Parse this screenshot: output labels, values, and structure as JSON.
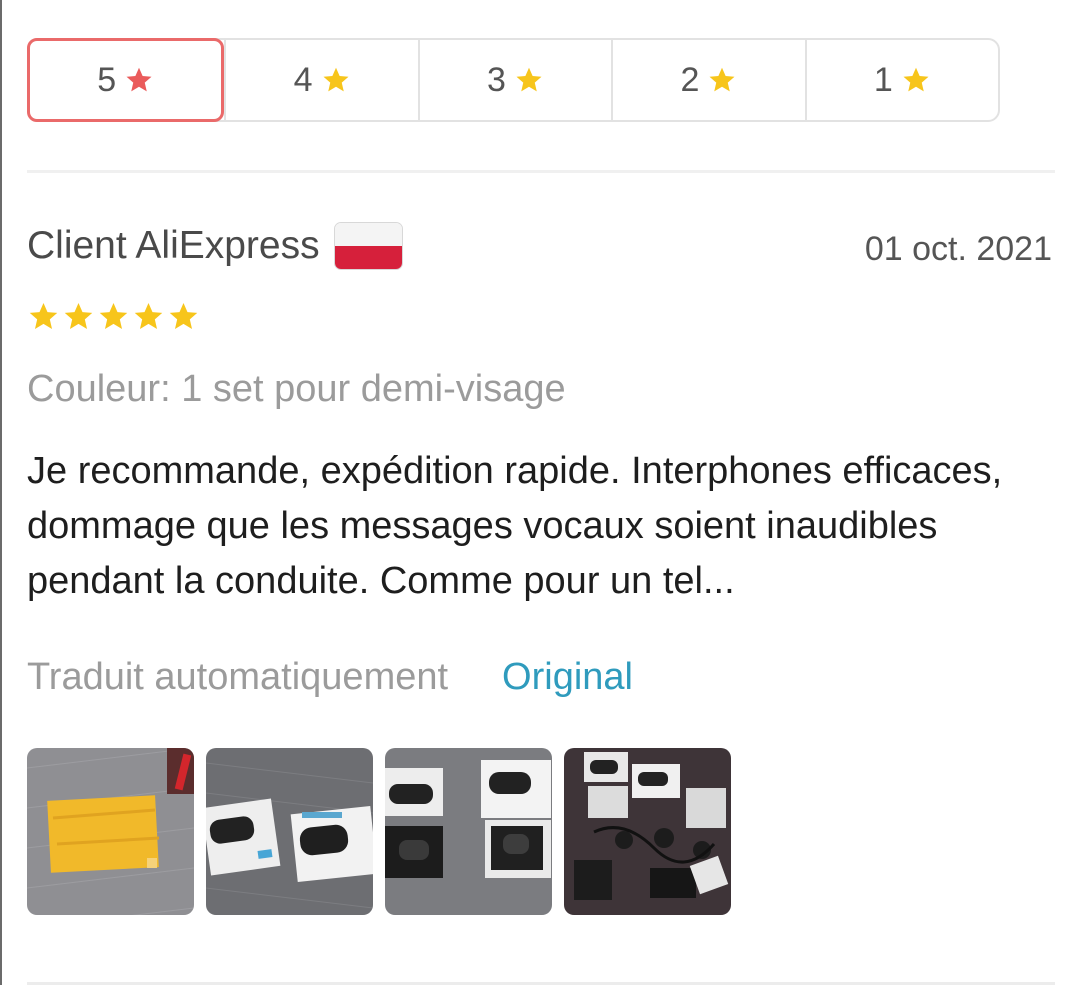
{
  "filters": [
    {
      "label": "5",
      "active": true,
      "star_color": "#ea5b5b"
    },
    {
      "label": "4",
      "active": false,
      "star_color": "#f7c51b"
    },
    {
      "label": "3",
      "active": false,
      "star_color": "#f7c51b"
    },
    {
      "label": "2",
      "active": false,
      "star_color": "#f7c51b"
    },
    {
      "label": "1",
      "active": false,
      "star_color": "#f7c51b"
    }
  ],
  "review": {
    "author": "Client AliExpress",
    "country_flag_icon": "poland-flag-icon",
    "date": "01 oct. 2021",
    "rating": 5,
    "variant": "Couleur: 1 set pour demi-visage",
    "text": "Je recommande, expédition rapide. Interphones efficaces, dommage que les messages vocaux soient inaudibles pendant la conduite. Comme pour un tel...",
    "translated_label": "Traduit automatiquement",
    "original_link": "Original",
    "photos": [
      {
        "icon": "photo-yellow-package"
      },
      {
        "icon": "photo-intercom-boxes"
      },
      {
        "icon": "photo-intercom-boxes-open"
      },
      {
        "icon": "photo-intercom-kit-contents"
      }
    ]
  },
  "colors": {
    "active_border": "#ea6a6a",
    "star_yellow": "#f7c51b",
    "link_blue": "#2f9bbd"
  }
}
